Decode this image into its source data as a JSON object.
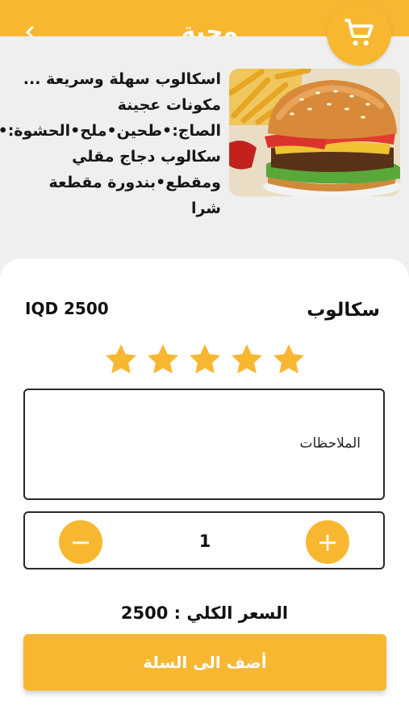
{
  "header": {
    "title": "وجبة",
    "back_icon": "chevron-left-icon",
    "cart_icon": "shopping-cart-icon",
    "accent": "#f7b731"
  },
  "description": {
    "lines": [
      "اسكالوب سهلة وسريعة ...",
      "مكونات عجينة",
      "الصاج:•طحين•ملح•الحشوة:•",
      "سكالوب دجاج مقلي",
      "ومقطع•بندورة مقطعة شرا"
    ]
  },
  "product": {
    "name": "سكالوب",
    "price": "IQD 2500",
    "rating": 5,
    "rating_max": 5,
    "image": "burger-with-fries-photo"
  },
  "notes": {
    "placeholder": "الملاحظات"
  },
  "quantity": {
    "value": "1",
    "minus_label": "−",
    "plus_label": "+"
  },
  "total": {
    "text": "السعر الكلي : 2500"
  },
  "actions": {
    "add_to_cart": "أضف الى السلة"
  }
}
